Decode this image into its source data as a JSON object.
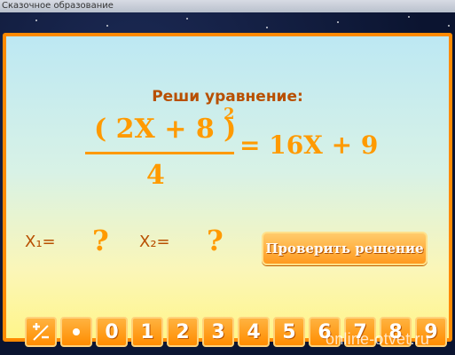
{
  "window": {
    "title": "Сказочное образование"
  },
  "task": {
    "heading": "Реши уравнение:",
    "numerator": "( 2X + 8 )",
    "exponent": "2",
    "denominator": "4",
    "right_side": "= 16X + 9"
  },
  "answers": {
    "x1_label": "X₁=",
    "x1_value": "?",
    "x2_label": "X₂=",
    "x2_value": "?"
  },
  "check_button": {
    "label": "Проверить решение"
  },
  "keyboard": {
    "sign_key": "+/−",
    "dot_key": "•",
    "digits": [
      "0",
      "1",
      "2",
      "3",
      "4",
      "5",
      "6",
      "7",
      "8",
      "9"
    ]
  },
  "watermark": "online-otvet.ru",
  "colors": {
    "accent": "#ff9a00",
    "dark_orange": "#b84f00",
    "frame": "#ff8a00"
  }
}
